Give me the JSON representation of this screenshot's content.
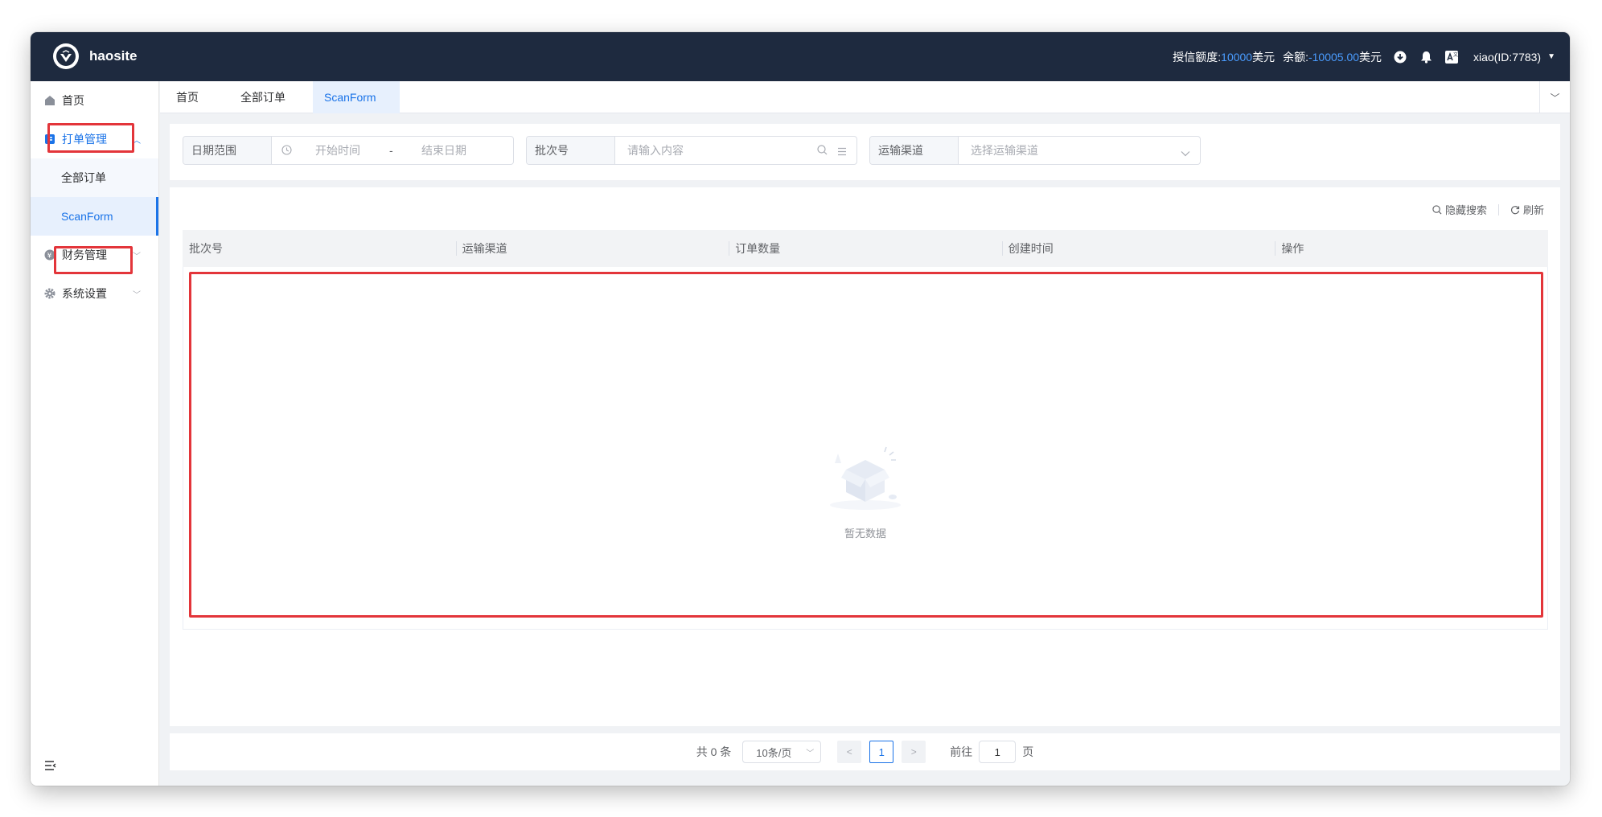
{
  "header": {
    "brand": "haosite",
    "credit_label": "授信额度:",
    "credit_value": "10000",
    "credit_unit": "美元",
    "balance_label": "余额:",
    "balance_value": "-10005.00",
    "balance_unit": "美元",
    "user": "xiao(ID:7783)",
    "accent_color": "#4a9cff"
  },
  "sidebar": {
    "items": [
      {
        "label": "首页",
        "icon": "home-icon"
      },
      {
        "label": "打单管理",
        "icon": "print-order-icon"
      },
      {
        "label": "财务管理",
        "icon": "finance-icon"
      },
      {
        "label": "系统设置",
        "icon": "gear-icon"
      }
    ],
    "sub_items": [
      {
        "label": "全部订单"
      },
      {
        "label": "ScanForm"
      }
    ]
  },
  "tabs": [
    {
      "label": "首页"
    },
    {
      "label": "全部订单"
    },
    {
      "label": "ScanForm"
    }
  ],
  "search": {
    "date_label": "日期范围",
    "start_placeholder": "开始时间",
    "date_sep": "-",
    "end_placeholder": "结束日期",
    "batch_label": "批次号",
    "batch_placeholder": "请输入内容",
    "channel_label": "运输渠道",
    "channel_placeholder": "选择运输渠道"
  },
  "toolbar": {
    "hide_search": "隐藏搜索",
    "refresh": "刷新"
  },
  "table": {
    "columns": [
      "批次号",
      "运输渠道",
      "订单数量",
      "创建时间",
      "操作"
    ],
    "rows": [],
    "empty_text": "暂无数据"
  },
  "pagination": {
    "total_text": "共 0 条",
    "page_size": "10条/页",
    "current_page": "1",
    "goto_label": "前往",
    "goto_value": "1",
    "page_suffix": "页"
  }
}
